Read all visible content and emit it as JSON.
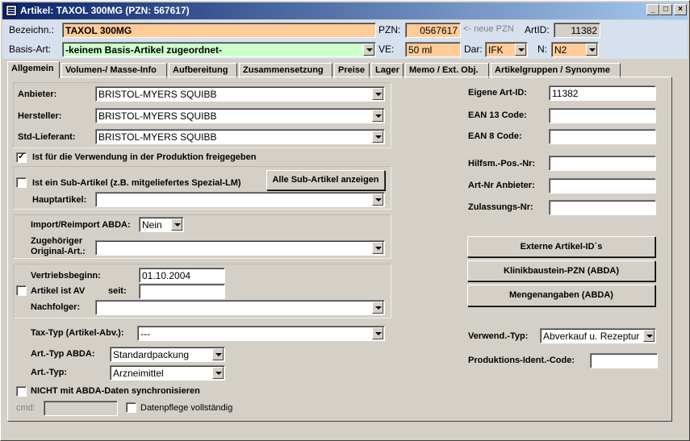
{
  "window": {
    "title": "Artikel: TAXOL 300MG (PZN: 567617)",
    "min": "_",
    "max": "□",
    "close": "×"
  },
  "header": {
    "bezeichn_label": "Bezeichn.:",
    "bezeichn_value": "TAXOL 300MG",
    "pzn_label": "PZN:",
    "pzn_value": "0567617",
    "neue_pzn": "<- neue PZN",
    "artid_label": "ArtID:",
    "artid_value": "11382",
    "basis_label": "Basis-Art:",
    "basis_value": "-keinem Basis-Artikel zugeordnet-",
    "ve_label": "VE:",
    "ve_value": "50 ml",
    "dar_label": "Dar:",
    "dar_value": "IFK",
    "n_label": "N:",
    "n_value": "N2"
  },
  "tabs": [
    "Allgemein",
    "Volumen-/ Masse-Info",
    "Aufbereitung",
    "Zusammensetzung",
    "Preise",
    "Lager",
    "Memo / Ext. Obj.",
    "Artikelgruppen / Synonyme"
  ],
  "left": {
    "anbieter_label": "Anbieter:",
    "anbieter_value": "BRISTOL-MYERS SQUIBB",
    "hersteller_label": "Hersteller:",
    "hersteller_value": "BRISTOL-MYERS SQUIBB",
    "stdlief_label": "Std-Lieferant:",
    "stdlief_value": "BRISTOL-MYERS SQUIBB",
    "produktion_label": "Ist für die Verwendung in der Produktion freigegeben",
    "subartikel_label": "Ist ein Sub-Artikel (z.B. mitgeliefertes Spezial-LM)",
    "sub_button": "Alle Sub-Artikel anzeigen",
    "hauptartikel_label": "Hauptartikel:",
    "import_label": "Import/Reimport ABDA:",
    "import_value": "Nein",
    "zugeh_label1": "Zugehöriger",
    "zugeh_label2": "Original-Art.:",
    "vertrieb_label": "Vertriebsbeginn:",
    "vertrieb_value": "01.10.2004",
    "av_label": "Artikel ist AV",
    "seit_label": "seit:",
    "nachfolger_label": "Nachfolger:",
    "taxtyp_label": "Tax-Typ (Artikel-Abv.):",
    "taxtyp_value": "---",
    "arttyp_abda_label": "Art.-Typ ABDA:",
    "arttyp_abda_value": "Standardpackung",
    "arttyp_label": "Art.-Typ:",
    "arttyp_value": "Arzneimittel",
    "nicht_abda_label": "NICHT mit ABDA-Daten synchronisieren",
    "cmd_label": "cmd:",
    "datenpflege_label": "Datenpflege vollständig"
  },
  "right": {
    "eigene_label": "Eigene Art-ID:",
    "eigene_value": "11382",
    "ean13_label": "EAN 13 Code:",
    "ean8_label": "EAN 8 Code:",
    "hilfsm_label": "Hilfsm.-Pos.-Nr:",
    "artnr_label": "Art-Nr Anbieter:",
    "zulassung_label": "Zulassungs-Nr:",
    "btn_extern": "Externe Artikel-ID´s",
    "btn_klinik": "Klinikbaustein-PZN (ABDA)",
    "btn_menge": "Mengenangaben (ABDA)",
    "verwend_label": "Verwend.-Typ:",
    "verwend_value": "Abverkauf u. Rezeptur",
    "prodident_label": "Produktions-Ident.-Code:"
  }
}
